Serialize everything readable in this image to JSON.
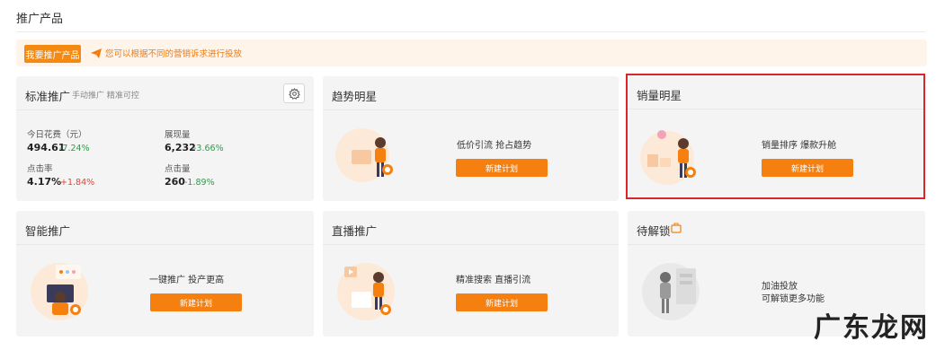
{
  "page": {
    "title": "推广产品"
  },
  "banner": {
    "button_label": "我要推广产品",
    "tip_icon": "paper-plane-icon",
    "tip_text": "您可以根据不同的营销诉求进行投放"
  },
  "standard": {
    "title": "标准推广",
    "subtitle": "手动推广 精准可控",
    "settings_icon": "gear-icon",
    "metrics": [
      {
        "label": "今日花费（元）",
        "value": "494.61",
        "delta": "-7.24%",
        "trend": "down"
      },
      {
        "label": "展现量",
        "value": "6,232",
        "delta": "-3.66%",
        "trend": "down"
      },
      {
        "label": "点击率",
        "value": "4.17%",
        "delta": "+1.84%",
        "trend": "up"
      },
      {
        "label": "点击量",
        "value": "260",
        "delta": "-1.89%",
        "trend": "down"
      }
    ]
  },
  "trend_star": {
    "title": "趋势明星",
    "tagline": "低价引流 抢占趋势",
    "cta": "新建计划"
  },
  "sales_star": {
    "title": "销量明星",
    "tagline": "销量排序 爆款升舱",
    "cta": "新建计划"
  },
  "smart": {
    "title": "智能推广",
    "tagline": "一键推广 投产更高",
    "cta": "新建计划"
  },
  "live": {
    "title": "直播推广",
    "tagline": "精准搜索 直播引流",
    "cta": "新建计划"
  },
  "locked": {
    "title": "待解锁",
    "icon": "briefcase-icon",
    "line1": "加油投放",
    "line2": "可解锁更多功能"
  },
  "watermark": {
    "text": "广东龙网"
  },
  "colors": {
    "accent": "#f5800f",
    "up": "#e0443a",
    "down": "#2e9b4a",
    "highlight": "#d9252b"
  }
}
